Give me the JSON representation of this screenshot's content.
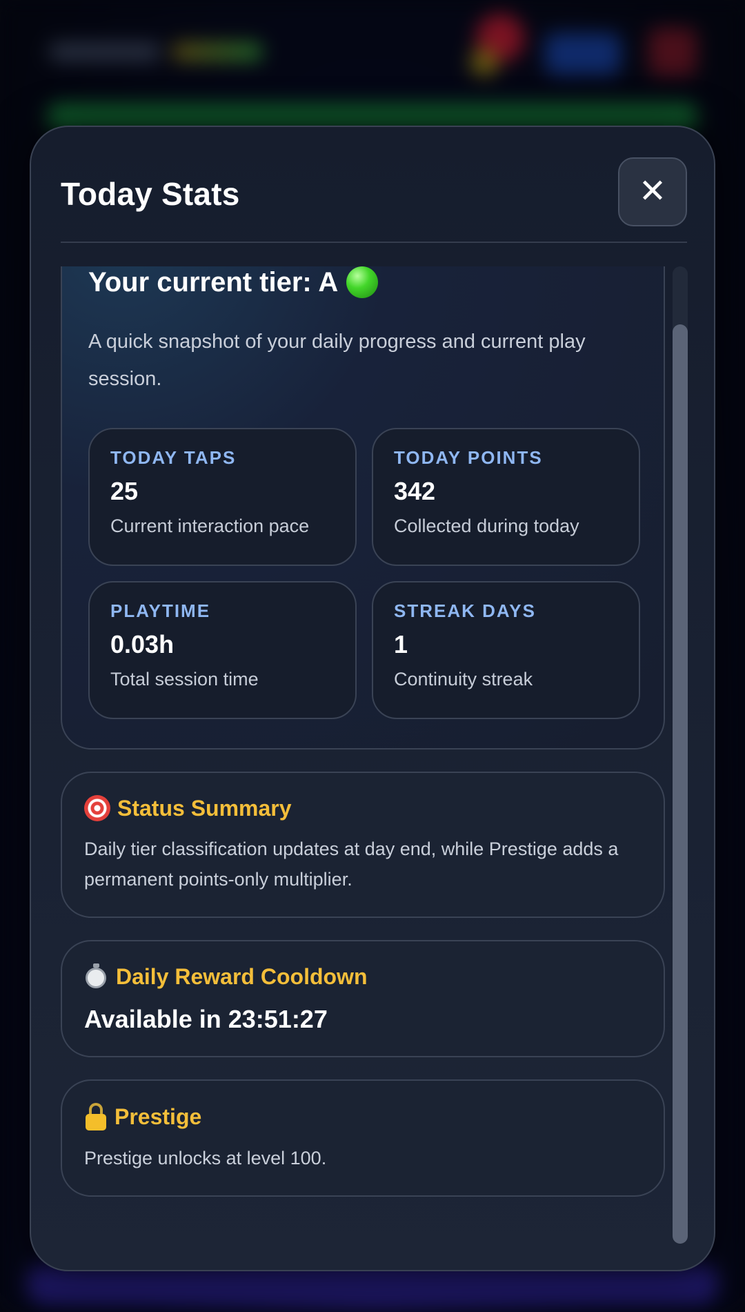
{
  "modal": {
    "title": "Today Stats",
    "close_label": "✕"
  },
  "tier": {
    "title": "Your current tier: A",
    "indicator_color": "#43d62a",
    "description": "A quick snapshot of your daily progress and current play session."
  },
  "stats": [
    {
      "label": "TODAY TAPS",
      "value": "25",
      "sub": "Current interaction pace"
    },
    {
      "label": "TODAY POINTS",
      "value": "342",
      "sub": "Collected during today"
    },
    {
      "label": "PLAYTIME",
      "value": "0.03h",
      "sub": "Total session time"
    },
    {
      "label": "STREAK DAYS",
      "value": "1",
      "sub": "Continuity streak"
    }
  ],
  "status_summary": {
    "icon": "target-icon",
    "title": "Status Summary",
    "text": "Daily tier classification updates at day end, while Prestige adds a permanent points-only multiplier."
  },
  "daily_reward": {
    "icon": "stopwatch-icon",
    "title": "Daily Reward Cooldown",
    "value": "Available in 23:51:27"
  },
  "prestige": {
    "icon": "lock-icon",
    "title": "Prestige",
    "text": "Prestige unlocks at level 100."
  },
  "colors": {
    "accent_heading": "#f4be3a",
    "stat_label": "#8fb7f2",
    "modal_bg": "#1a2233"
  }
}
